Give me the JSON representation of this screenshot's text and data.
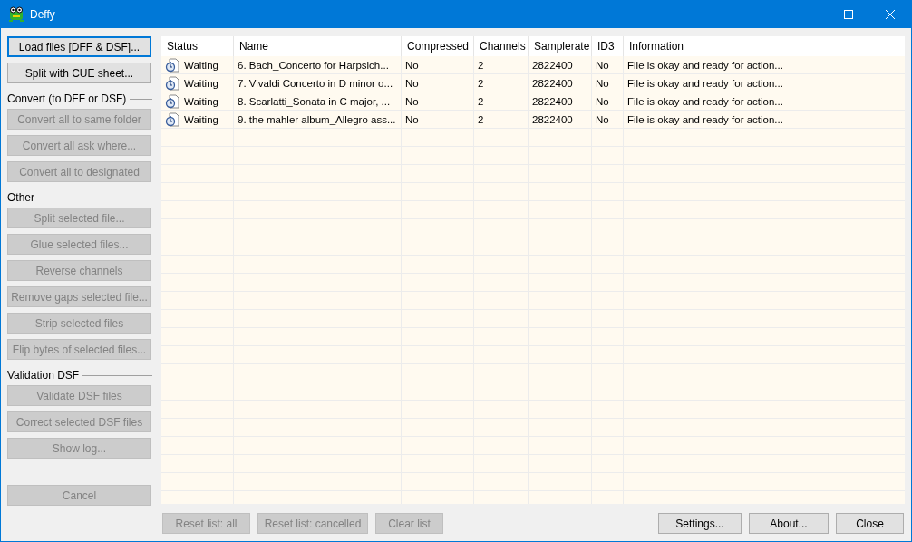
{
  "window": {
    "title": "Deffy"
  },
  "top_buttons": [
    {
      "label": "Load files [DFF & DSF]...",
      "disabled": false,
      "focused": true
    },
    {
      "label": "Split with CUE sheet...",
      "disabled": false,
      "focused": false
    }
  ],
  "sections": [
    {
      "title": "Convert (to DFF or DSF)",
      "buttons": [
        {
          "label": "Convert all to same folder",
          "disabled": true,
          "focused": false
        },
        {
          "label": "Convert all ask where...",
          "disabled": true,
          "focused": false
        },
        {
          "label": "Convert all to designated",
          "disabled": true,
          "focused": false
        }
      ]
    },
    {
      "title": "Other",
      "buttons": [
        {
          "label": "Split selected file...",
          "disabled": true,
          "focused": false
        },
        {
          "label": "Glue selected files...",
          "disabled": true,
          "focused": false
        },
        {
          "label": "Reverse channels",
          "disabled": true,
          "focused": false
        },
        {
          "label": "Remove gaps selected file...",
          "disabled": true,
          "focused": false
        },
        {
          "label": "Strip selected files",
          "disabled": true,
          "focused": false
        },
        {
          "label": "Flip bytes of selected files...",
          "disabled": true,
          "focused": false
        }
      ]
    },
    {
      "title": "Validation DSF",
      "buttons": [
        {
          "label": "Validate DSF files",
          "disabled": true,
          "focused": false
        },
        {
          "label": "Correct selected DSF files",
          "disabled": true,
          "focused": false
        },
        {
          "label": "Show log...",
          "disabled": true,
          "focused": false
        }
      ]
    }
  ],
  "cancel_button": {
    "label": "Cancel",
    "disabled": true,
    "focused": false
  },
  "table": {
    "columns": [
      "Status",
      "Name",
      "Compressed",
      "Channels",
      "Samplerate",
      "ID3",
      "Information"
    ],
    "rows": [
      [
        "Waiting",
        "6. Bach_Concerto for Harpsich...",
        "No",
        "2",
        "2822400",
        "No",
        "File is okay and ready for action..."
      ],
      [
        "Waiting",
        "7. Vivaldi Concerto in D minor o...",
        "No",
        "2",
        "2822400",
        "No",
        "File is okay and ready for action..."
      ],
      [
        "Waiting",
        "8. Scarlatti_Sonata in C major, ...",
        "No",
        "2",
        "2822400",
        "No",
        "File is okay and ready for action..."
      ],
      [
        "Waiting",
        "9. the mahler album_Allegro ass...",
        "No",
        "2",
        "2822400",
        "No",
        "File is okay and ready for action..."
      ]
    ]
  },
  "bottom_left_buttons": [
    {
      "label": "Reset list: all",
      "disabled": true,
      "focused": false
    },
    {
      "label": "Reset list: cancelled",
      "disabled": true,
      "focused": false
    },
    {
      "label": "Clear list",
      "disabled": true,
      "focused": false
    }
  ],
  "bottom_right_buttons": [
    {
      "label": "Settings...",
      "disabled": false,
      "focused": false
    },
    {
      "label": "About...",
      "disabled": false,
      "focused": false
    },
    {
      "label": "Close",
      "disabled": false,
      "focused": false
    }
  ]
}
